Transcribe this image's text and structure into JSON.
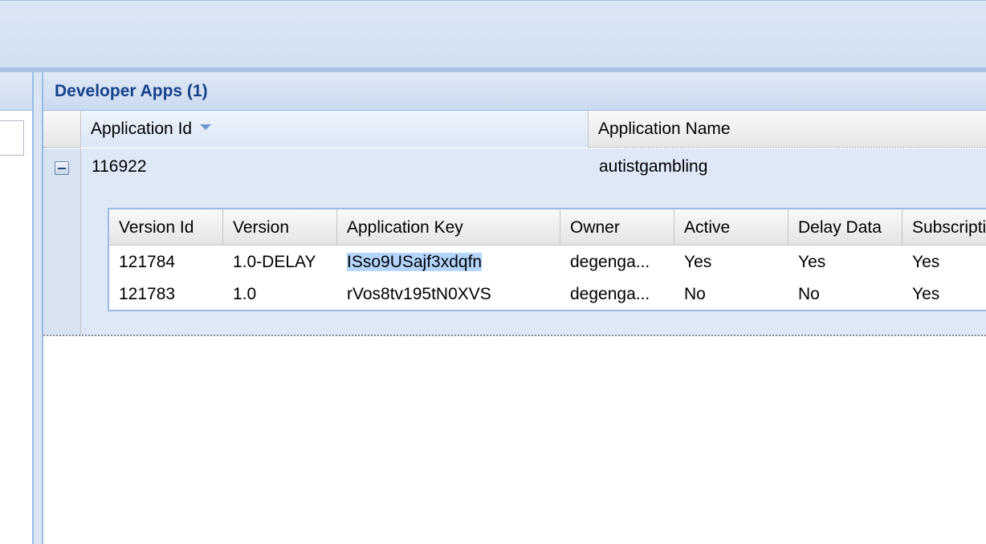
{
  "panel": {
    "title": "Developer Apps (1)"
  },
  "grid": {
    "columns": [
      "Application Id",
      "Application Name"
    ],
    "sorted_column": "Application Id",
    "rows": [
      {
        "application_id": "116922",
        "application_name": "autistgambling",
        "expanded": true
      }
    ]
  },
  "versions": {
    "columns": [
      "Version Id",
      "Version",
      "Application Key",
      "Owner",
      "Active",
      "Delay Data",
      "Subscripti"
    ],
    "rows": [
      [
        "121784",
        "1.0-DELAY",
        "ISso9USajf3xdqfn",
        "degenga...",
        "Yes",
        "Yes",
        "Yes"
      ],
      [
        "121783",
        "1.0",
        "rVos8tv195tN0XVS",
        "degenga...",
        "No",
        "No",
        "Yes"
      ]
    ],
    "selected_text": "ISso9USajf3xdqfn"
  },
  "colors": {
    "title": "#15428b",
    "panel_border": "#99bbe8",
    "row_bg": "#dfe8f6",
    "selection": "#b4d5fe"
  },
  "icons": {
    "expander": "collapse-minus-icon",
    "sort": "sort-descending-icon"
  }
}
